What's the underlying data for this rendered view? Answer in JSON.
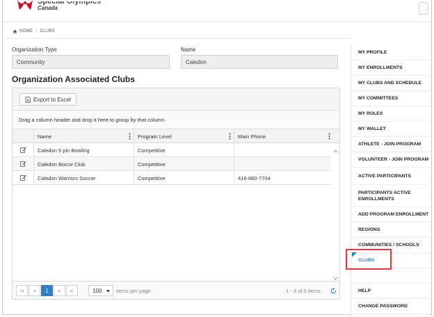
{
  "header": {
    "brand_line": "Special Olympics",
    "brand_sub": "Canada"
  },
  "breadcrumb": {
    "home": "HOME",
    "current": "CLUBS"
  },
  "form": {
    "org_type_label": "Organization Type",
    "org_type_value": "Community",
    "name_label": "Name",
    "name_value": "Caledon"
  },
  "section_title": "Organization Associated Clubs",
  "grid": {
    "export_label": "Export to Excel",
    "group_hint": "Drag a column header and drop it here to group by that column",
    "columns": [
      "Name",
      "Program Level",
      "Main Phone"
    ],
    "rows": [
      {
        "name": "Caledon 5 pin Bowling",
        "level": "Competitive",
        "phone": ""
      },
      {
        "name": "Caledon Bocce Club",
        "level": "Competitive",
        "phone": ""
      },
      {
        "name": "Caledon Warriors Soccer",
        "level": "Competitive",
        "phone": "416-880-7704"
      }
    ],
    "pager": {
      "first": "|◂",
      "prev": "◂",
      "current_page": "1",
      "next": "▸",
      "last": "▸|",
      "page_size": "100",
      "items_per_page": "items per page",
      "summary": "1 - 3 of 3 items"
    }
  },
  "nav": {
    "items": [
      "MY PROFILE",
      "MY ENROLLMENTS",
      "MY CLUBS AND SCHEDULE",
      "MY COMMITTEES",
      "MY ROLES",
      "MY WALLET",
      "ATHLETE - JOIN PROGRAM",
      "VOLUNTEER - JOIN PROGRAM",
      "ACTIVE PARTICIPANTS",
      "PARTICIPANTS ACTIVE ENROLLMENTS",
      "ADD PROGRAM ENROLLMENT",
      "REGIONS",
      "COMMUNITIES / SCHOOLS",
      "CLUBS",
      "",
      "HELP",
      "CHANGE PASSWORD"
    ]
  },
  "colors": {
    "accent": "#2f7fc8",
    "highlight": "#e03a3a",
    "logo": "#c8102e"
  }
}
